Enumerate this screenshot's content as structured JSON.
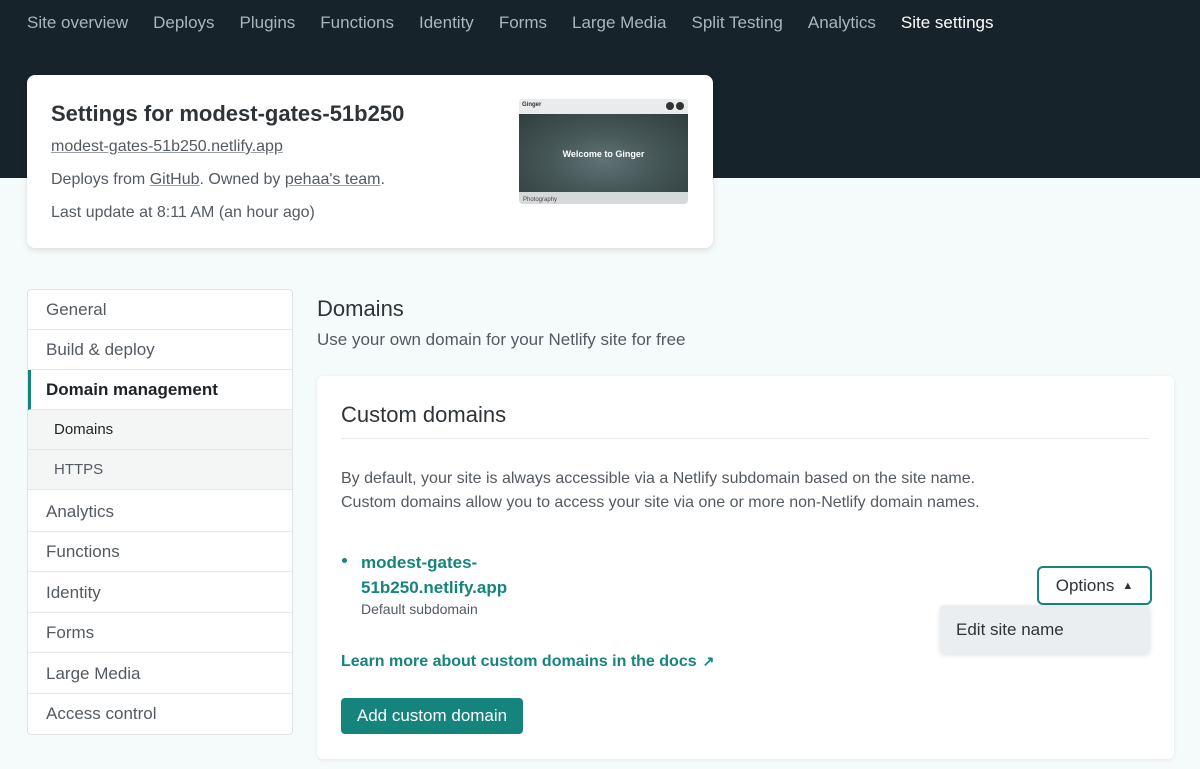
{
  "topnav": {
    "items": [
      {
        "label": "Site overview",
        "active": false
      },
      {
        "label": "Deploys",
        "active": false
      },
      {
        "label": "Plugins",
        "active": false
      },
      {
        "label": "Functions",
        "active": false
      },
      {
        "label": "Identity",
        "active": false
      },
      {
        "label": "Forms",
        "active": false
      },
      {
        "label": "Large Media",
        "active": false
      },
      {
        "label": "Split Testing",
        "active": false
      },
      {
        "label": "Analytics",
        "active": false
      },
      {
        "label": "Site settings",
        "active": true
      }
    ]
  },
  "site": {
    "title": "Settings for modest-gates-51b250",
    "url": "modest-gates-51b250.netlify.app",
    "deploys_prefix": "Deploys from ",
    "deploys_source": "GitHub",
    "owned_prefix": ". Owned by ",
    "owner": "pehaa's team",
    "owned_suffix": ".",
    "last_update": "Last update at 8:11 AM (an hour ago)",
    "preview": {
      "brand": "Ginger",
      "hero_text": "Welcome to Ginger",
      "footer_text": "Photography"
    }
  },
  "sidenav": {
    "items": [
      {
        "label": "General"
      },
      {
        "label": "Build & deploy"
      },
      {
        "label": "Domain management"
      },
      {
        "label": "Domains"
      },
      {
        "label": "HTTPS"
      },
      {
        "label": "Analytics"
      },
      {
        "label": "Functions"
      },
      {
        "label": "Identity"
      },
      {
        "label": "Forms"
      },
      {
        "label": "Large Media"
      },
      {
        "label": "Access control"
      }
    ]
  },
  "section": {
    "title": "Domains",
    "subtitle": "Use your own domain for your Netlify site for free"
  },
  "panel": {
    "title": "Custom domains",
    "desc_line1": "By default, your site is always accessible via a Netlify subdomain based on the site name.",
    "desc_line2": "Custom domains allow you to access your site via one or more non-Netlify domain names.",
    "domain_line1": "modest-gates-",
    "domain_line2": "51b250.netlify.app",
    "domain_note": "Default subdomain",
    "options_label": "Options",
    "dropdown_item": "Edit site name",
    "docs_link": "Learn more about custom domains in the docs",
    "add_button": "Add custom domain"
  },
  "colors": {
    "accent": "#15847d",
    "header_bg": "#16232a",
    "page_bg": "#f5fafa"
  }
}
